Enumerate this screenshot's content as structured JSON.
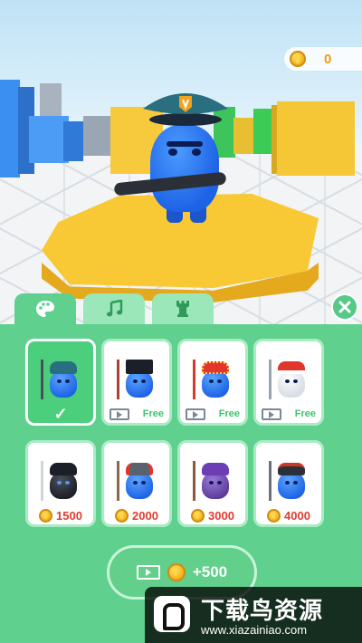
{
  "hud": {
    "coins": "0",
    "coin_icon": "coin-icon"
  },
  "tabs": [
    {
      "icon": "palette-icon",
      "active": true
    },
    {
      "icon": "music-note-icon",
      "active": false
    },
    {
      "icon": "chess-rook-icon",
      "active": false
    }
  ],
  "close_icon": "close-icon",
  "skins": [
    {
      "id": "police",
      "state": "selected",
      "weapon": "baton"
    },
    {
      "id": "top-hat",
      "state": "free",
      "footer_label": "Free",
      "weapon": "cane"
    },
    {
      "id": "opera",
      "state": "free",
      "footer_label": "Free",
      "weapon": "staff"
    },
    {
      "id": "santa",
      "state": "free",
      "footer_label": "Free",
      "weapon": "lollipop"
    },
    {
      "id": "ninja",
      "state": "price",
      "price": "1500",
      "weapon": "katana"
    },
    {
      "id": "viking",
      "state": "price",
      "price": "2000",
      "weapon": "axe"
    },
    {
      "id": "wizard",
      "state": "price",
      "price": "3000",
      "weapon": "spear"
    },
    {
      "id": "samurai",
      "state": "price",
      "price": "4000",
      "weapon": "halberd"
    }
  ],
  "ad_button": {
    "label": "+500",
    "icon": "video-icon"
  },
  "watermark": {
    "title": "下载鸟资源",
    "url": "www.xiazainiao.com"
  },
  "colors": {
    "panel": "#5fd08d",
    "price": "#e23c2e",
    "free": "#3cc46a",
    "coin_text": "#f29a12"
  }
}
